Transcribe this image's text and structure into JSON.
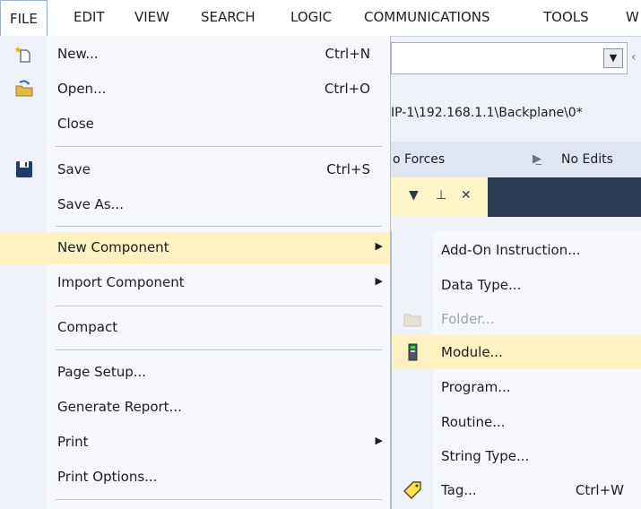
{
  "menubar": {
    "items": [
      "FILE",
      "EDIT",
      "VIEW",
      "SEARCH",
      "LOGIC",
      "COMMUNICATIONS",
      "TOOLS",
      "W"
    ]
  },
  "background": {
    "path": "IP-1\\192.168.1.1\\Backplane\\0*",
    "forces": "o Forces",
    "edits": "No Edits",
    "tail": "‹",
    "pane_buttons": [
      "▼",
      "⊥",
      "✕"
    ]
  },
  "file_menu": {
    "items": [
      {
        "label": "New...",
        "shortcut": "Ctrl+N",
        "icon": "new-file-icon"
      },
      {
        "label": "Open...",
        "shortcut": "Ctrl+O",
        "icon": "open-folder-icon"
      },
      {
        "label": "Close",
        "shortcut": ""
      },
      {
        "label": "Save",
        "shortcut": "Ctrl+S",
        "icon": "save-disk-icon"
      },
      {
        "label": "Save As...",
        "shortcut": ""
      },
      {
        "label": "New Component",
        "shortcut": "",
        "submenu": true
      },
      {
        "label": "Import Component",
        "shortcut": "",
        "submenu": true
      },
      {
        "label": "Compact",
        "shortcut": ""
      },
      {
        "label": "Page Setup...",
        "shortcut": ""
      },
      {
        "label": "Generate Report...",
        "shortcut": ""
      },
      {
        "label": "Print",
        "shortcut": "",
        "submenu": true
      },
      {
        "label": "Print Options...",
        "shortcut": ""
      }
    ]
  },
  "submenu": {
    "items": [
      {
        "label": "Add-On Instruction...",
        "shortcut": ""
      },
      {
        "label": "Data Type...",
        "shortcut": ""
      },
      {
        "label": "Folder...",
        "shortcut": "",
        "disabled": true,
        "icon": "folder-icon"
      },
      {
        "label": "Module...",
        "shortcut": "",
        "icon": "module-icon"
      },
      {
        "label": "Program...",
        "shortcut": ""
      },
      {
        "label": "Routine...",
        "shortcut": ""
      },
      {
        "label": "String Type...",
        "shortcut": ""
      },
      {
        "label": "Tag...",
        "shortcut": "Ctrl+W",
        "icon": "tag-icon"
      }
    ]
  },
  "colors": {
    "highlight": "#fdf1c0",
    "menu_bg": "#f5f7fb",
    "dark_bar": "#2d3a55"
  }
}
